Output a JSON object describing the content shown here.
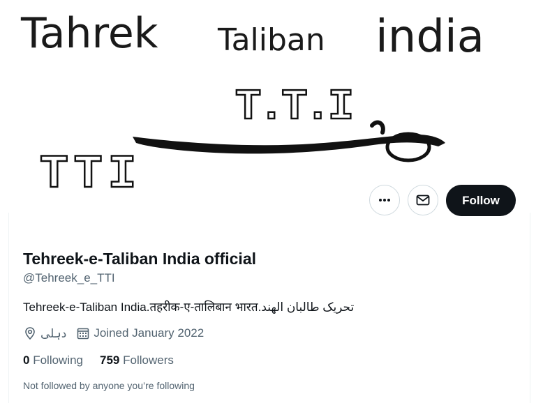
{
  "banner": {
    "line1_word1": "Tahrek",
    "line1_word2": "Taliban",
    "line1_word3": "india",
    "logo_top": "T.T.I",
    "logo_left": "TTI"
  },
  "actions": {
    "more_icon": "more-horizontal-icon",
    "message_icon": "envelope-icon",
    "follow_label": "Follow"
  },
  "profile": {
    "display_name": "Tehreek-e-Taliban India official",
    "handle": "@Tehreek_e_TTI",
    "bio": "Tehreek-e-Taliban India.तहरीक-ए-तालिबान भारत.تحریک طالبان الهند",
    "location": "دہلی",
    "joined": "Joined January 2022"
  },
  "stats": {
    "following_count": "0",
    "following_label": "Following",
    "followers_count": "759",
    "followers_label": "Followers"
  },
  "followed_by_note": "Not followed by anyone you’re following",
  "colors": {
    "follow_bg": "#0f1419",
    "secondary_text": "#536471",
    "border": "#cfd9de"
  }
}
